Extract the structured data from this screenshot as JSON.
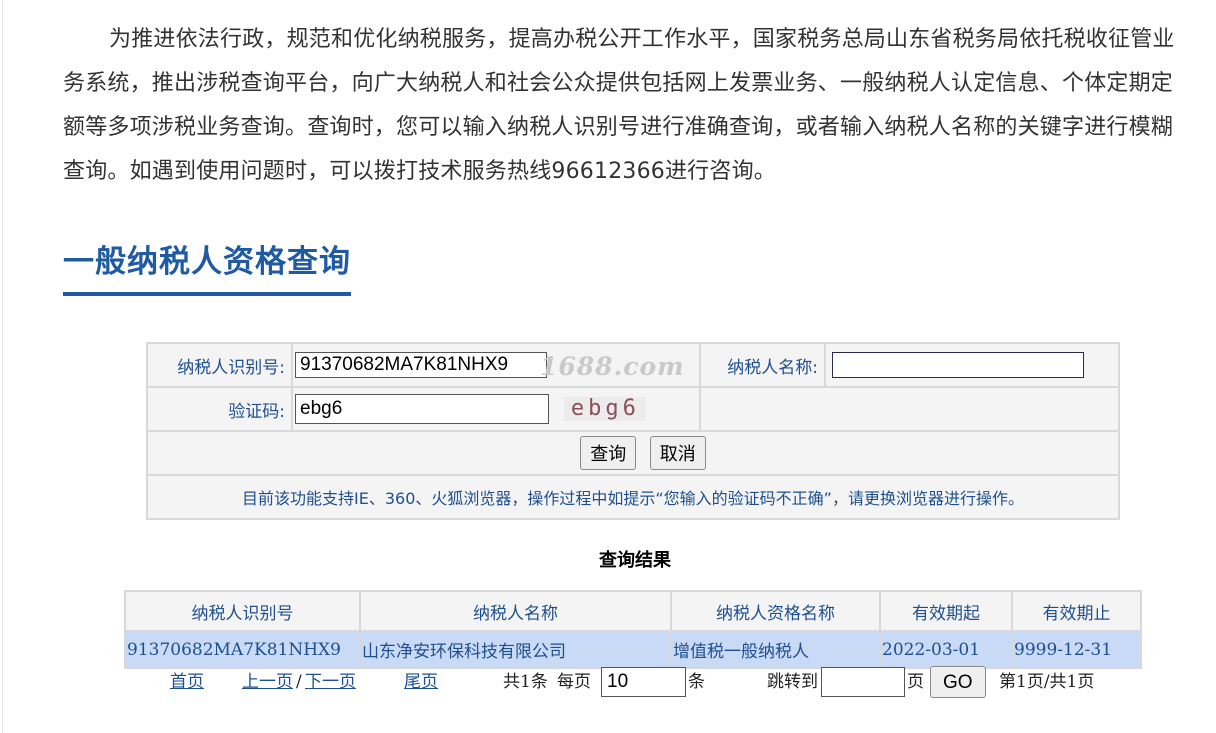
{
  "intro": "为推进依法行政，规范和优化纳税服务，提高办税公开工作水平，国家税务总局山东省税务局依托税收征管业务系统，推出涉税查询平台，向广大纳税人和社会公众提供包括网上发票业务、一般纳税人认定信息、个体定期定额等多项涉税业务查询。查询时，您可以输入纳税人识别号进行准确查询，或者输入纳税人名称的关键字进行模糊查询。如遇到使用问题时，可以拨打技术服务热线96612366进行咨询。",
  "section_title": "一般纳税人资格查询",
  "form": {
    "taxpayer_id_label": "纳税人识别号:",
    "taxpayer_id_value": "91370682MA7K81NHX9",
    "taxpayer_name_label": "纳税人名称:",
    "taxpayer_name_value": "",
    "captcha_label": "验证码:",
    "captcha_value": "ebg6",
    "captcha_image_text": "ebg6",
    "query_button": "查询",
    "cancel_button": "取消",
    "notice": "目前该功能支持IE、360、火狐浏览器，操作过程中如提示“您输入的验证码不正确”，请更换浏览器进行操作。"
  },
  "watermark": "1688.com",
  "results": {
    "title": "查询结果",
    "columns": [
      "纳税人识别号",
      "纳税人名称",
      "纳税人资格名称",
      "有效期起",
      "有效期止"
    ],
    "rows": [
      [
        "91370682MA7K81NHX9",
        "山东净安环保科技有限公司",
        "增值税一般纳税人",
        "2022-03-01",
        "9999-12-31"
      ]
    ]
  },
  "pager": {
    "first": "首页",
    "prev": "上一页",
    "separator": "/",
    "next": "下一页",
    "last": "尾页",
    "total": "共1条",
    "per_page_label": "每页",
    "per_page_value": "10",
    "per_page_unit": "条",
    "jump_label": "跳转到",
    "jump_value": "",
    "page_unit": "页",
    "go_button": "GO",
    "page_info": "第1页/共1页"
  },
  "colors": {
    "accent": "#1f5aa3",
    "link": "#1f4f8f",
    "row_highlight": "#c8daf5"
  }
}
